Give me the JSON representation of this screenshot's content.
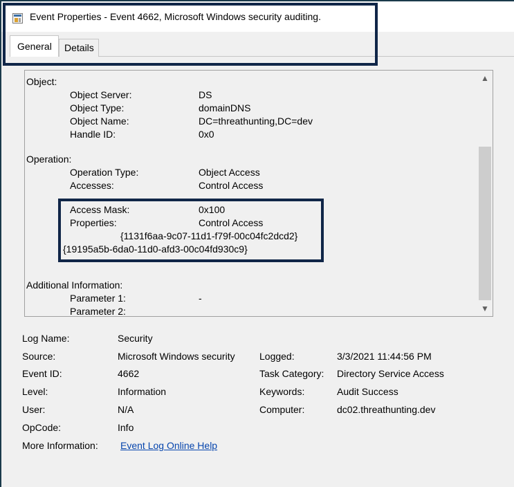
{
  "window": {
    "title": "Event Properties - Event 4662, Microsoft Windows security auditing."
  },
  "tabs": [
    {
      "label": "General",
      "selected": true
    },
    {
      "label": "Details",
      "selected": false
    }
  ],
  "description": {
    "lines": [
      "Object:",
      "Object Server:",
      "DS",
      "Object Type:",
      "domainDNS",
      "Object Name:",
      "DC=threathunting,DC=dev",
      "Handle ID:",
      "0x0",
      "Operation:",
      "Operation Type:",
      "Object Access",
      "Accesses:",
      "Control Access",
      "Access Mask:",
      "0x100",
      "Properties:",
      "Control Access",
      "{1131f6aa-9c07-11d1-f79f-00c04fc2dcd2}",
      "{19195a5b-6da0-11d0-afd3-00c04fd930c9}",
      "Additional Information:",
      "Parameter 1:",
      "-",
      "Parameter 2:"
    ]
  },
  "scrollbar": {
    "up_icon": "▲",
    "down_icon": "▼"
  },
  "properties": {
    "log_name_label": "Log Name:",
    "log_name": "Security",
    "source_label": "Source:",
    "source": "Microsoft Windows security",
    "logged_label": "Logged:",
    "logged": "3/3/2021 11:44:56 PM",
    "event_id_label": "Event ID:",
    "event_id": "4662",
    "task_category_label": "Task Category:",
    "task_category": "Directory Service Access",
    "level_label": "Level:",
    "level": "Information",
    "keywords_label": "Keywords:",
    "keywords": "Audit Success",
    "user_label": "User:",
    "user": "N/A",
    "computer_label": "Computer:",
    "computer": "dc02.threathunting.dev",
    "opcode_label": "OpCode:",
    "opcode": "Info",
    "more_info_label": "More Information:",
    "more_info_link": "Event Log Online Help"
  },
  "colors": {
    "annotation": "#102648",
    "link": "#0645ad"
  }
}
